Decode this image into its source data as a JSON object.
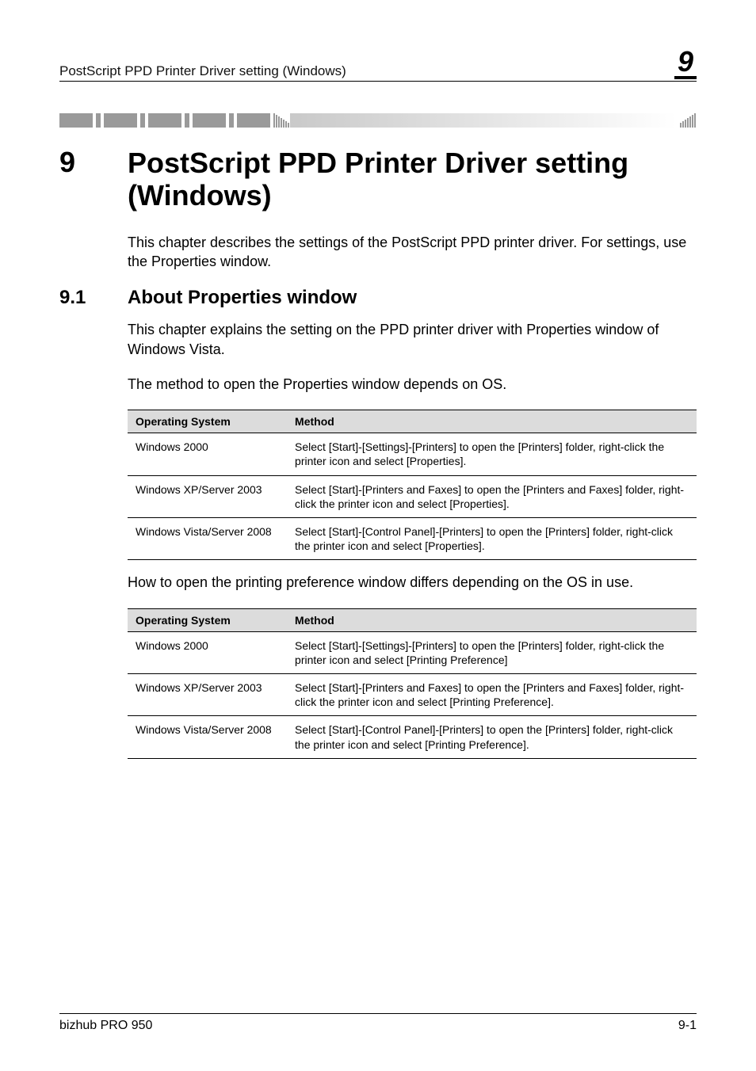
{
  "header": {
    "running_title": "PostScript PPD Printer Driver setting (Windows)",
    "chapter_badge": "9"
  },
  "chapter": {
    "number": "9",
    "title": "PostScript PPD Printer Driver setting (Windows)",
    "intro": "This chapter describes the settings of the PostScript PPD printer driver. For settings, use the Properties window."
  },
  "section": {
    "number": "9.1",
    "title": "About Properties window",
    "p1": "This chapter explains the setting on the PPD printer driver with Properties window of Windows Vista.",
    "p2": "The method to open the Properties window depends on OS.",
    "p3": "How to open the printing preference window differs depending on the OS in use."
  },
  "table1": {
    "headers": {
      "os": "Operating System",
      "method": "Method"
    },
    "rows": [
      {
        "os": "Windows 2000",
        "method": "Select [Start]-[Settings]-[Printers] to open the [Printers] folder, right-click the printer icon and select [Properties]."
      },
      {
        "os": "Windows XP/Server 2003",
        "method": "Select [Start]-[Printers and Faxes] to open the [Printers and Faxes] folder, right-click the printer icon and select [Properties]."
      },
      {
        "os": "Windows Vista/Server 2008",
        "method": "Select [Start]-[Control Panel]-[Printers] to open the [Printers] folder, right-click the printer icon and select [Properties]."
      }
    ]
  },
  "table2": {
    "headers": {
      "os": "Operating System",
      "method": "Method"
    },
    "rows": [
      {
        "os": "Windows 2000",
        "method": "Select [Start]-[Settings]-[Printers] to open the [Printers] folder, right-click the printer icon and select [Printing Preference]"
      },
      {
        "os": "Windows XP/Server 2003",
        "method": "Select [Start]-[Printers and Faxes] to open the [Printers and Faxes] folder, right-click the printer icon and select [Printing Preference]."
      },
      {
        "os": "Windows Vista/Server 2008",
        "method": "Select [Start]-[Control Panel]-[Printers] to open the [Printers] folder, right-click the printer icon and select [Printing Preference]."
      }
    ]
  },
  "footer": {
    "product": "bizhub PRO 950",
    "page": "9-1"
  }
}
